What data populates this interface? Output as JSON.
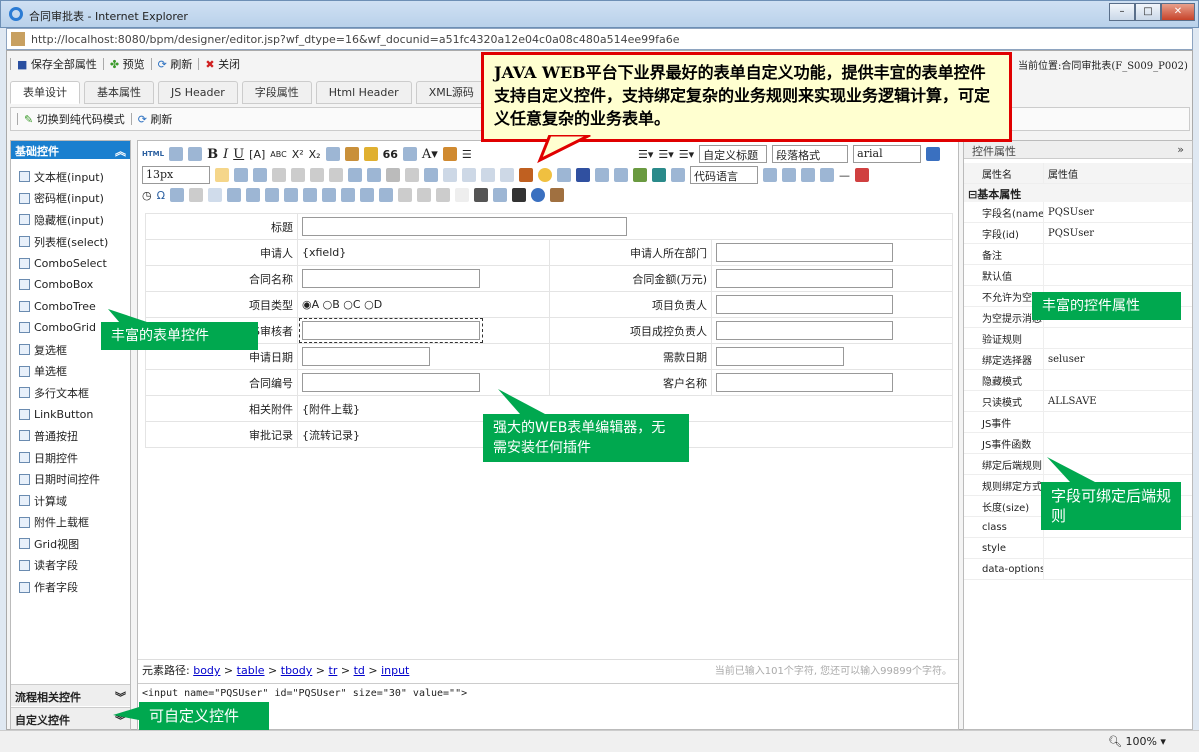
{
  "window": {
    "title": "合同审批表 - Internet Explorer",
    "url": "http://localhost:8080/bpm/designer/editor.jsp?wf_dtype=16&wf_docunid=a51fc4320a12e04c0a08c480a514ee99fa6e"
  },
  "toolbar": {
    "save": "保存全部属性",
    "preview": "预览",
    "refresh": "刷新",
    "close": "关闭",
    "location": "当前位置:合同审批表(F_S009_P002)"
  },
  "tabs": [
    "表单设计",
    "基本属性",
    "JS Header",
    "字段属性",
    "Html Header",
    "XML源码"
  ],
  "subtoolbar": {
    "switch": "切换到纯代码模式",
    "refresh": "刷新"
  },
  "left": {
    "header": "基础控件",
    "items": [
      "文本框(input)",
      "密码框(input)",
      "隐藏框(input)",
      "列表框(select)",
      "ComboSelect",
      "ComboBox",
      "ComboTree",
      "ComboGrid",
      "复选框",
      "单选框",
      "多行文本框",
      "LinkButton",
      "普通按扭",
      "日期控件",
      "日期时间控件",
      "计算域",
      "附件上载框",
      "Grid视图",
      "读者字段",
      "作者字段"
    ],
    "footer1": "流程相关控件",
    "footer2": "自定义控件"
  },
  "editor": {
    "heading_select": "自定义标题",
    "para_select": "段落格式",
    "font_select": "arial",
    "size_select": "13px",
    "code_select": "代码语言",
    "form": {
      "title": "标题",
      "applicant": "申请人",
      "applicant_val": "{xfield}",
      "dept": "申请人所在部门",
      "contract_name": "合同名称",
      "amount": "合同金额(万元)",
      "type": "项目类型",
      "radios": [
        "A",
        "B",
        "C",
        "D"
      ],
      "owner": "项目负责人",
      "reviewer": "QS审核者",
      "approver": "项目成控负责人",
      "apply_date": "申请日期",
      "pay_date": "需款日期",
      "contract_no": "合同编号",
      "customer": "客户名称",
      "attach": "相关附件",
      "attach_val": "{附件上载}",
      "record": "审批记录",
      "record_val": "{流转记录}"
    },
    "path_label": "元素路径:",
    "path": [
      "body",
      "table",
      "tbody",
      "tr",
      "td",
      "input"
    ],
    "count": "当前已输入101个字符, 您还可以输入99899个字符。",
    "code": "<input name=\"PQSUser\" id=\"PQSUser\" size=\"30\" value=\"\">"
  },
  "right": {
    "header": "控件属性",
    "col1": "属性名",
    "col2": "属性值",
    "group": "基本属性",
    "rows": [
      [
        "字段名(name)",
        "PQSUser"
      ],
      [
        "字段(id)",
        "PQSUser"
      ],
      [
        "备注",
        ""
      ],
      [
        "默认值",
        ""
      ],
      [
        "不允许为空",
        ""
      ],
      [
        "为空提示消息",
        ""
      ],
      [
        "验证规则",
        ""
      ],
      [
        "绑定选择器",
        "seluser"
      ],
      [
        "隐藏模式",
        ""
      ],
      [
        "只读模式",
        "ALLSAVE"
      ],
      [
        "JS事件",
        ""
      ],
      [
        "JS事件函数",
        ""
      ],
      [
        "绑定后端规则",
        ""
      ],
      [
        "规则绑定方式",
        ""
      ],
      [
        "长度(size)",
        ""
      ],
      [
        "class",
        ""
      ],
      [
        "style",
        ""
      ],
      [
        "data-options",
        ""
      ]
    ]
  },
  "status": {
    "zoom": "100%"
  },
  "callouts": {
    "red": "JAVA WEB平台下业界最好的表单自定义功能，提供丰宜的表单控件支持自定义控件，支持绑定复杂的业务规则来实现业务逻辑计算，可定义任意复杂的业务表单。",
    "form_controls": "丰富的表单控件",
    "props": "丰富的控件属性",
    "editor": "强大的WEB表单编辑器，无需安装任何插件",
    "rules": "字段可绑定后端规则",
    "custom": "可自定义控件"
  },
  "colors": {
    "accent": "#1a7fcf",
    "callout_green": "#00a84f",
    "callout_red": "#e00000"
  }
}
